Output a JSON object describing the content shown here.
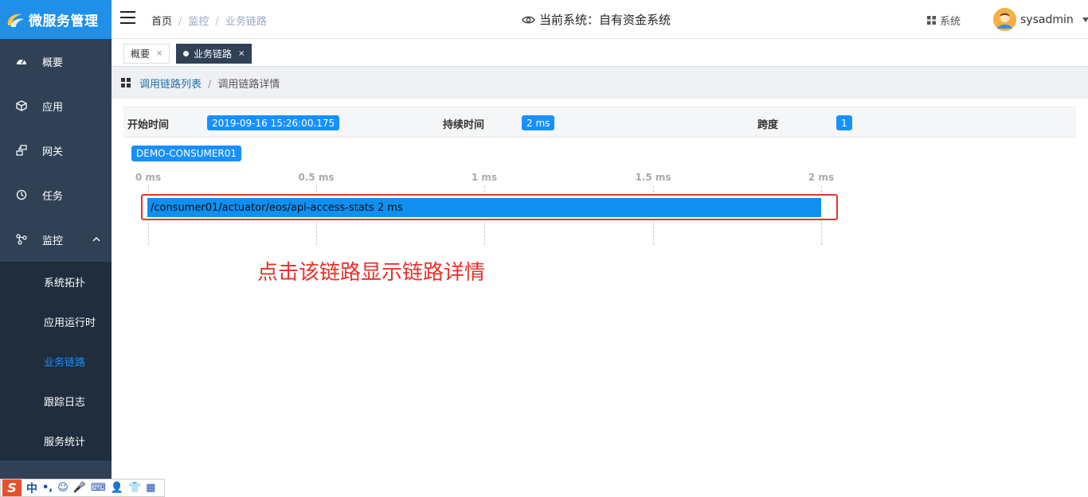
{
  "app": {
    "title": "微服务管理"
  },
  "sidebar": {
    "items": [
      {
        "label": "概要",
        "icon": "dashboard-icon"
      },
      {
        "label": "应用",
        "icon": "cube-icon"
      },
      {
        "label": "网关",
        "icon": "network-icon"
      },
      {
        "label": "任务",
        "icon": "clock-icon"
      },
      {
        "label": "监控",
        "icon": "monitor-icon",
        "expanded": true
      }
    ],
    "submenu": [
      {
        "label": "系统拓扑"
      },
      {
        "label": "应用运行时"
      },
      {
        "label": "业务链路",
        "active": true
      },
      {
        "label": "跟踪日志"
      },
      {
        "label": "服务统计"
      }
    ]
  },
  "header": {
    "breadcrumb": [
      "首页",
      "监控",
      "业务链路"
    ],
    "current_system": "当前系统：自有资金系统",
    "system_button": "系统",
    "username": "sysadmin"
  },
  "tags": [
    {
      "label": "概要",
      "close": "×",
      "active": false
    },
    {
      "label": "业务链路",
      "close": "×",
      "active": true
    }
  ],
  "page_breadcrumb": {
    "link": "调用链路列表",
    "current": "调用链路详情"
  },
  "trace": {
    "start_label": "开始时间",
    "start_value": "2019-09-16 15:26:00.175",
    "duration_label": "持续时间",
    "duration_value": "2 ms",
    "span_label": "跨度",
    "span_value": "1",
    "service": "DEMO-CONSUMER01",
    "ticks": [
      "0 ms",
      "0.5 ms",
      "1 ms",
      "1.5 ms",
      "2 ms"
    ],
    "span_text": "/consumer01/actuator/eos/api-access-stats 2 ms"
  },
  "annotation": "点击该链路显示链路详情",
  "ime": {
    "s_logo": "S",
    "mode": "中",
    "punct": "•,",
    "emoji": "☺",
    "mic": "🎤",
    "kbd": "⌨",
    "user": "👤",
    "shirt": "👕",
    "grid": "▦"
  },
  "colors": {
    "sidebar": "#304156",
    "logo": "#1f8fe8",
    "accent": "#1890ff",
    "highlight": "#e53333"
  }
}
